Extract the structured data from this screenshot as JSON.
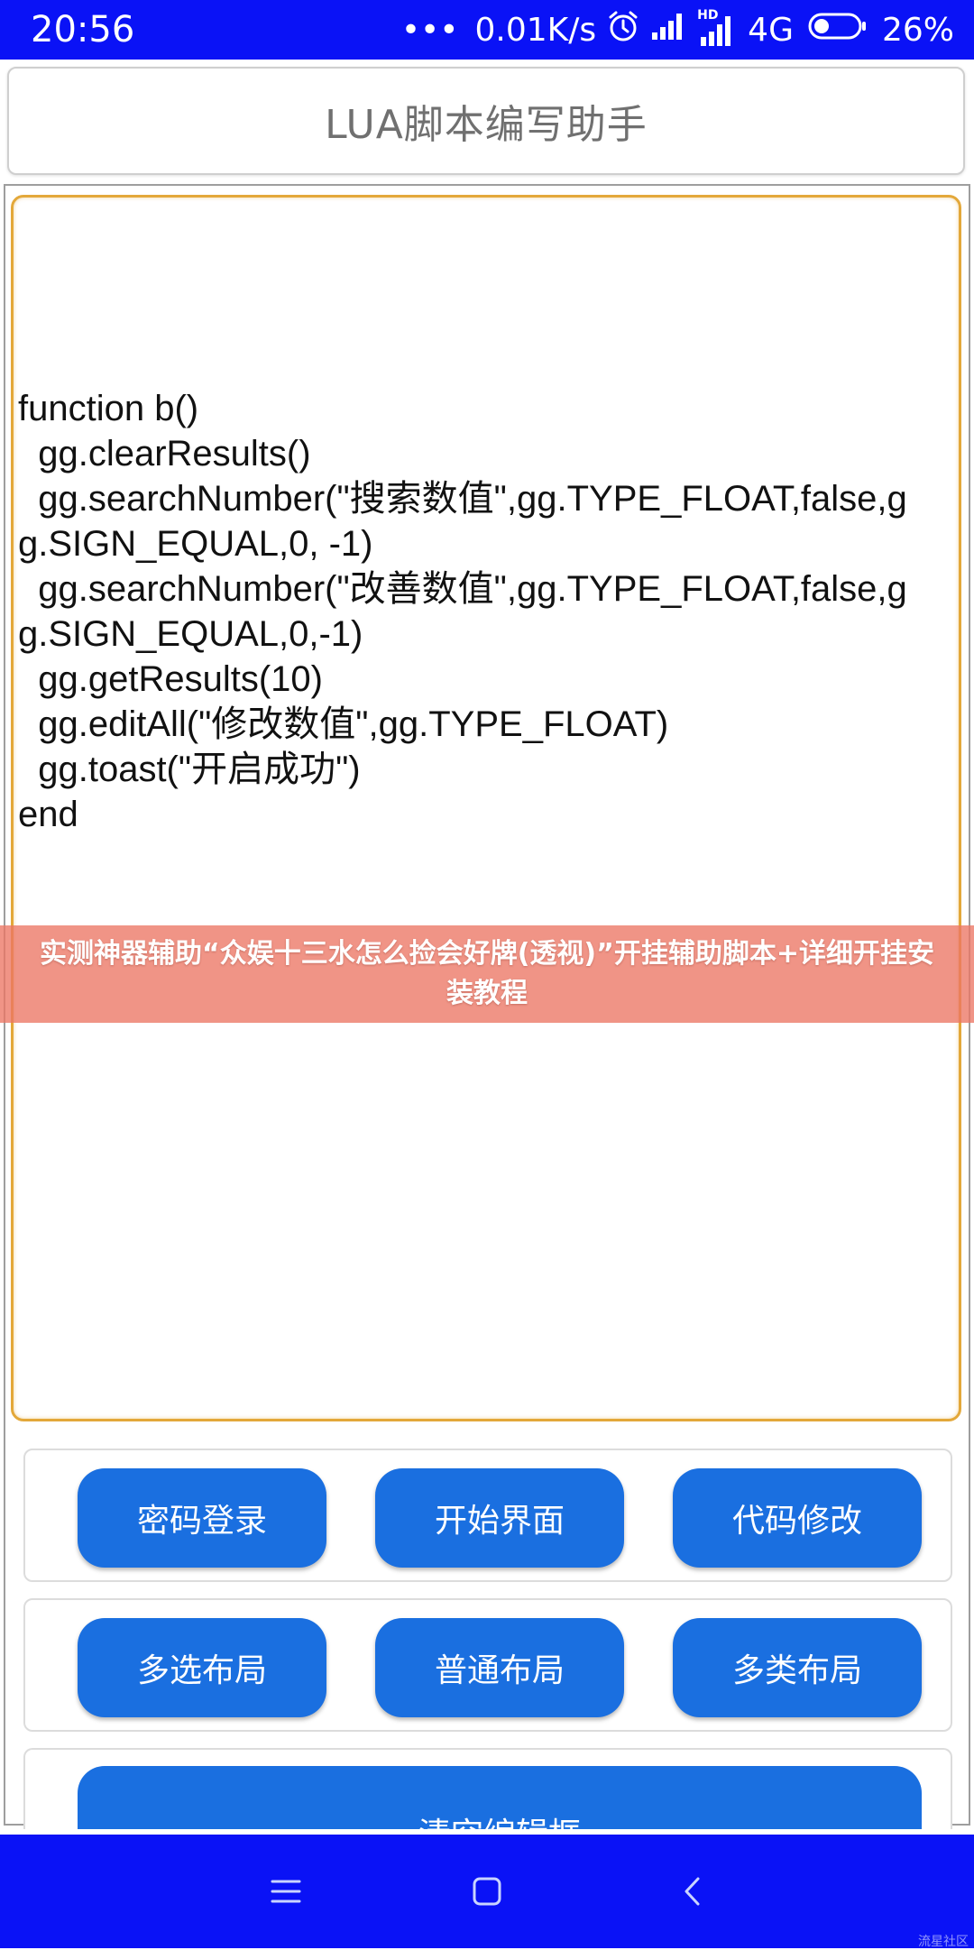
{
  "status_bar": {
    "time": "20:56",
    "speed": "0.01K/s",
    "hd_label": "HD",
    "network": "4G",
    "battery": "26%",
    "icons": [
      "more-dots-icon",
      "alarm-icon",
      "signal-icon",
      "hd-signal-icon",
      "battery-icon"
    ],
    "background": "#0a12f6"
  },
  "header": {
    "title": "LUA脚本编写助手"
  },
  "editor": {
    "code": "function b()\n  gg.clearResults()\n  gg.searchNumber(\"搜索数值\",gg.TYPE_FLOAT,false,gg.SIGN_EQUAL,0, -1)\n  gg.searchNumber(\"改善数值\",gg.TYPE_FLOAT,false,gg.SIGN_EQUAL,0,-1)\n  gg.getResults(10)\n  gg.editAll(\"修改数值\",gg.TYPE_FLOAT)\n  gg.toast(\"开启成功\")\nend",
    "border_color": "#e3a83a"
  },
  "buttons": {
    "row1": [
      "密码登录",
      "开始界面",
      "代码修改"
    ],
    "row2": [
      "多选布局",
      "普通布局",
      "多类布局"
    ],
    "clear": "清空编辑框",
    "color": "#1a6fe0"
  },
  "overlay": {
    "text": "实测神器辅助“众娱十三水怎么捡会好牌(透视)”开挂辅助脚本+详细开挂安装教程",
    "color": "#ec7664"
  },
  "nav_bar": {
    "icons": [
      "menu-icon",
      "home-icon",
      "back-icon"
    ]
  },
  "watermark": "流星社区"
}
